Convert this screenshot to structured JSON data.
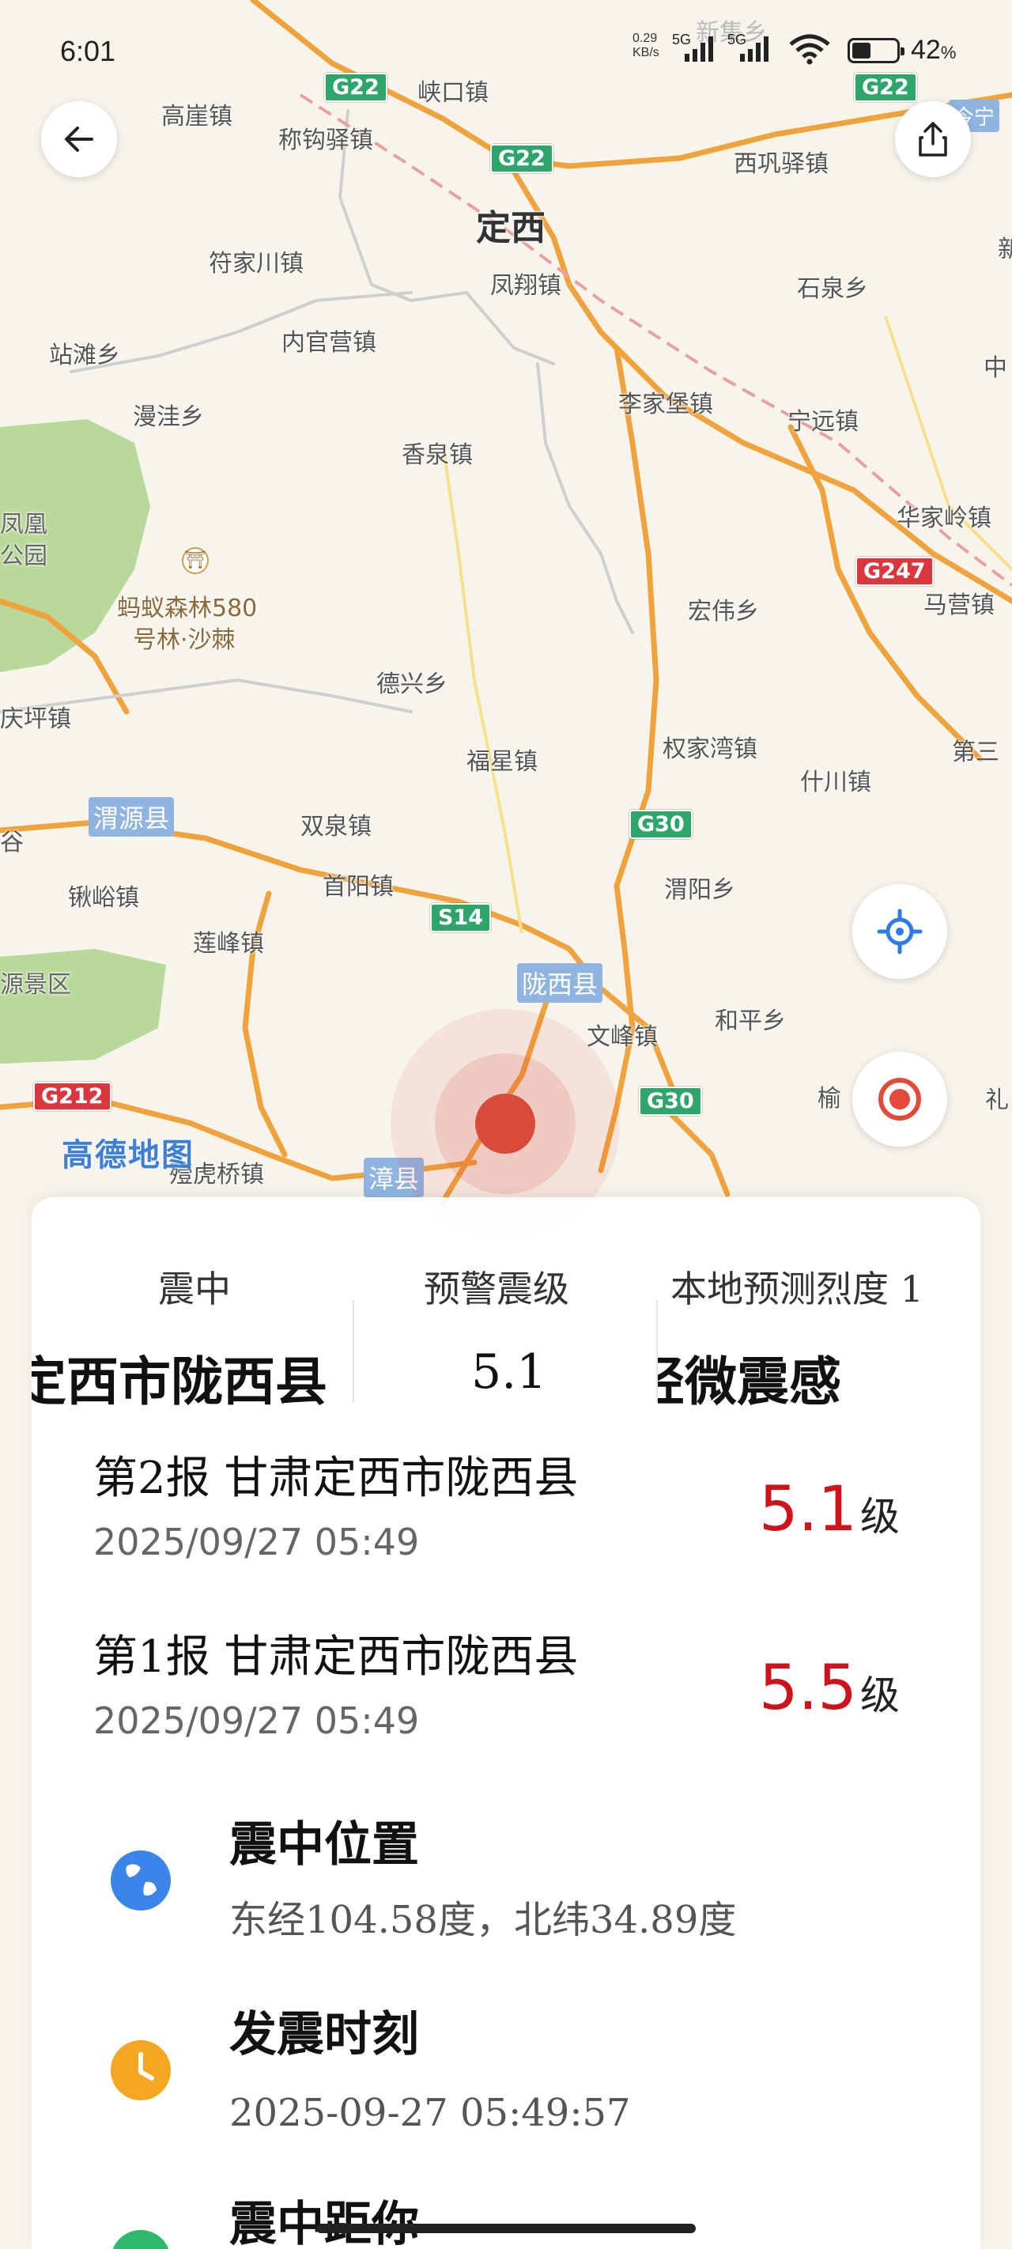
{
  "status_bar": {
    "time": "6:01",
    "net_speed": "0.29",
    "net_unit": "KB/s",
    "sim1": "5G",
    "sim2": "5G",
    "battery_percent": "42",
    "battery_level": 0.42,
    "percent_sign": "%"
  },
  "map": {
    "attribution": "高德地图",
    "city_label": "定西",
    "county_labels": [
      "渭源县",
      "陇西县",
      "漳县"
    ],
    "highways": [
      "G22",
      "G22",
      "G22",
      "G247",
      "G30",
      "G30",
      "S14",
      "G212"
    ],
    "places": [
      "新集乡",
      "峡口镇",
      "高崖镇",
      "称钩驿镇",
      "西巩驿镇",
      "符家川镇",
      "凤翔镇",
      "石泉乡",
      "站滩乡",
      "内官营镇",
      "漫洼乡",
      "李家堡镇",
      "宁远镇",
      "香泉镇",
      "华家岭镇",
      "凤凰",
      "公园",
      "蚂蚁森林580",
      "号林·沙棘",
      "马营镇",
      "宏伟乡",
      "德兴乡",
      "庆坪镇",
      "权家湾镇",
      "福星镇",
      "什川镇",
      "第三",
      "双泉镇",
      "锹峪镇",
      "首阳镇",
      "渭阳乡",
      "莲峰镇",
      "源景区",
      "文峰镇",
      "和平乡",
      "殪虎桥镇",
      "榆",
      "礼",
      "中",
      "新",
      "谷",
      "今宁"
    ]
  },
  "sheet": {
    "summary": {
      "epicenter_label": "震中",
      "magnitude_label": "预警震级",
      "intensity_label": "本地预测烈度",
      "intensity_value": "1",
      "epicenter_value": "定西市陇西县",
      "magnitude_value": "5.1",
      "intensity_desc": "轻微震感"
    },
    "reports": [
      {
        "title": "第2报  甘肃定西市陇西县",
        "datetime": "2025/09/27  05:49",
        "magnitude": "5.1",
        "unit": "级"
      },
      {
        "title": "第1报  甘肃定西市陇西县",
        "datetime": "2025/09/27  05:49",
        "magnitude": "5.5",
        "unit": "级"
      }
    ],
    "location": {
      "label": "震中位置",
      "value": "东经104.58度，北纬34.89度"
    },
    "time": {
      "label": "发震时刻",
      "value": "2025-09-27  05:49:57"
    },
    "distance": {
      "label": "震中距你"
    }
  },
  "colors": {
    "magnitude_red": "#d0121b",
    "globe_blue": "#3a86e8",
    "clock_orange": "#f5a623",
    "epicenter_red": "#d94a3a",
    "road_orange": "#f0a23c"
  }
}
